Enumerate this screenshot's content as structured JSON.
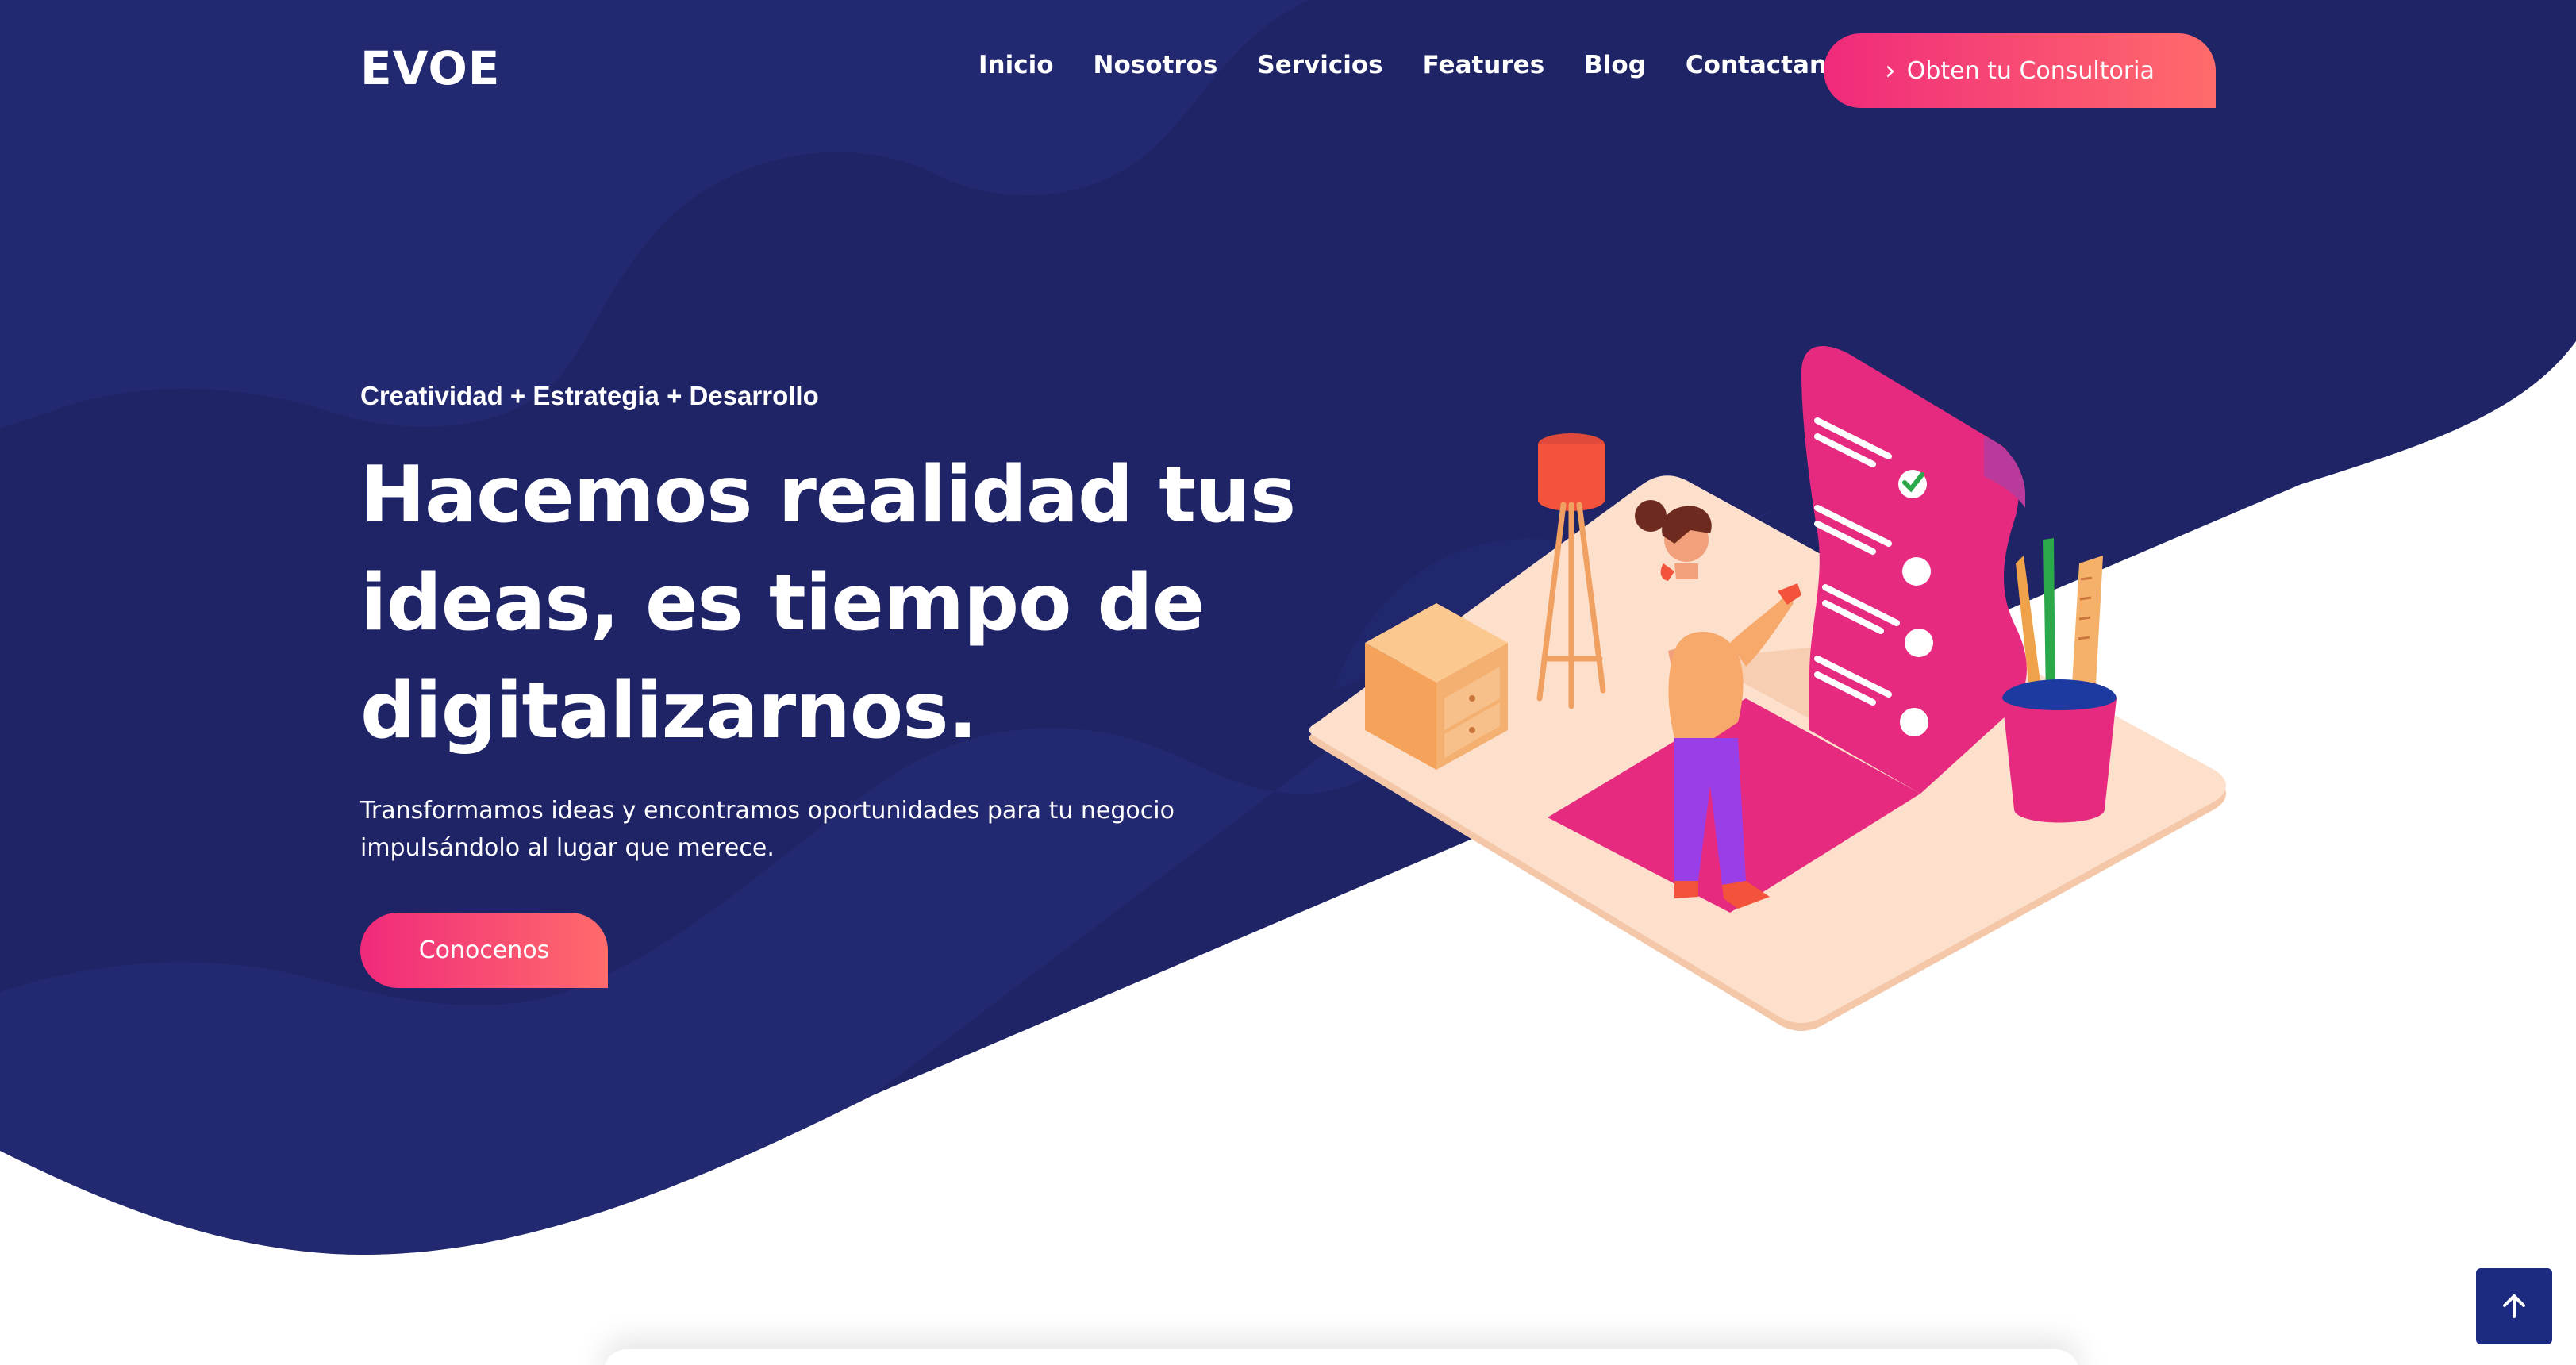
{
  "nav": {
    "logo": "EVOE",
    "links": [
      "Inicio",
      "Nosotros",
      "Servicios",
      "Features",
      "Blog",
      "Contactanos"
    ],
    "cta_label": "Obten tu Consultoria",
    "cta_icon": "chevron-right-icon"
  },
  "hero": {
    "tagline": "Creatividad + Estrategia + Desarrollo",
    "headline_lines": [
      "Hacemos realidad tus",
      "ideas, es tiempo de",
      "digitalizarnos."
    ],
    "subtext_lines": [
      "Transformamos ideas y encontramos oportunidades para tu negocio",
      "impulsándolo al lugar que merece."
    ],
    "button_label": "Conocenos"
  },
  "scroll_top": {
    "icon": "arrow-up-icon"
  },
  "colors": {
    "hero_bg": "#1f2466",
    "hero_bg_light": "#262d78",
    "accent_start": "#f02a7b",
    "accent_end": "#ff6b6b",
    "scroll_btn": "#1c2a80"
  }
}
